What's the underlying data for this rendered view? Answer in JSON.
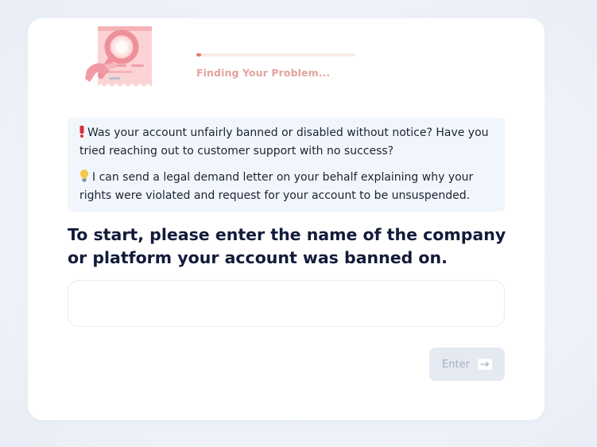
{
  "progress": {
    "label": "Finding Your Problem...",
    "fraction": 0.03
  },
  "info": {
    "warning_icon": "exclamation-icon",
    "warning_text": "Was your account unfairly banned or disabled without notice? Have you tried reaching out to customer support with no success?",
    "idea_icon": "lightbulb-icon",
    "idea_text": "I can send a legal demand letter on your behalf explaining why your rights were violated and request for your account to be unsuspended."
  },
  "question": {
    "text": "To start, please enter the name of the company or platform your account was banned on."
  },
  "answer_input": {
    "value": "",
    "placeholder": ""
  },
  "enter_button": {
    "label": "Enter",
    "icon": "arrow-right-icon"
  },
  "colors": {
    "accent": "#e47a70",
    "progress_track": "#fbeee7",
    "info_bg": "#f1f6fd",
    "heading": "#121b3a",
    "button_disabled_bg": "#e5e9f1",
    "button_disabled_text": "#a7b0c0"
  }
}
